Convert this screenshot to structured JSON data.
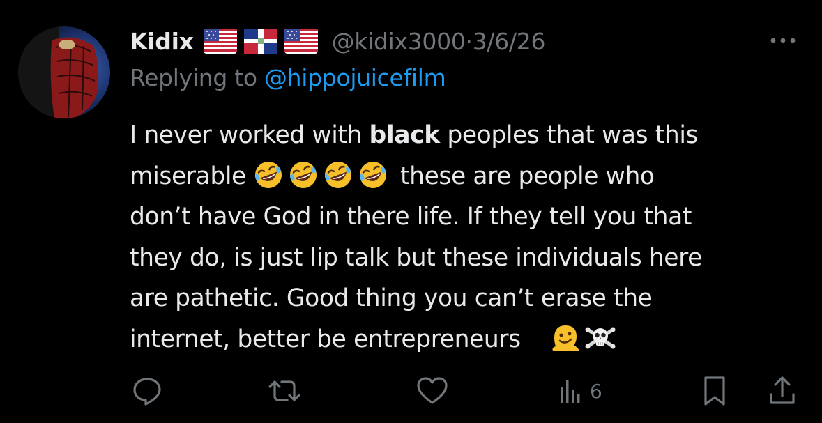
{
  "tweet": {
    "display_name": "Kidix",
    "flags": [
      "us-flag",
      "dominican-republic-flag",
      "us-flag"
    ],
    "handle": "@kidix3000",
    "separator": "·",
    "date": "3/6/26",
    "replying_to_label": "Replying to",
    "replying_to_handle": "@hippojuicefilm",
    "body_lines": [
      {
        "before": "I never worked with ",
        "bold": "black",
        "after": " peoples that was this"
      },
      {
        "before": "miserable",
        "emojis": [
          "rolling-on-floor-laughing",
          "rolling-on-floor-laughing",
          "rolling-on-floor-laughing",
          "rolling-on-floor-laughing"
        ],
        "after": " these are people who"
      },
      {
        "text": "don’t have God in there life. If they tell you that"
      },
      {
        "text": "they do, is just lip talk but these individuals here"
      },
      {
        "text": "are pathetic. Good thing you can’t erase the"
      },
      {
        "text": "internet, better be entrepreneurs",
        "emojis": [
          "melting-face",
          "skull-and-crossbones"
        ]
      }
    ]
  },
  "actions": {
    "reply": "reply-icon",
    "repost": "repost-icon",
    "like": "like-icon",
    "views_icon": "views-icon",
    "views_count": "6",
    "bookmark": "bookmark-icon",
    "share": "share-icon"
  },
  "colors": {
    "background": "#000000",
    "text_primary": "#e7e9ea",
    "text_secondary": "#71767b",
    "link": "#1d9bf0"
  }
}
